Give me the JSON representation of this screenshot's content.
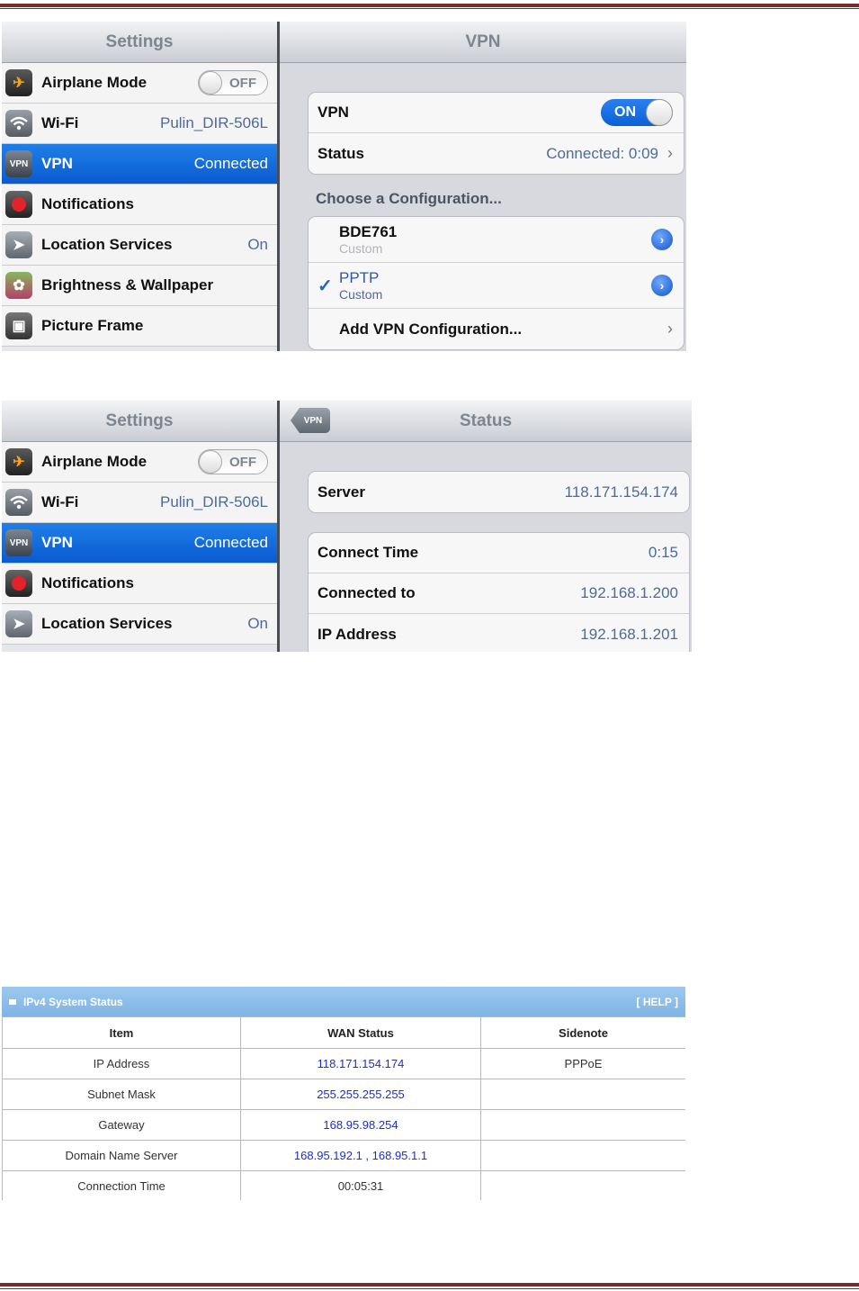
{
  "shot1": {
    "sidebar_title": "Settings",
    "detail_title": "VPN",
    "sidebar_items": [
      {
        "label": "Airplane Mode",
        "toggle": "OFF"
      },
      {
        "label": "Wi-Fi",
        "value": "Pulin_DIR-506L"
      },
      {
        "label": "VPN",
        "value": "Connected",
        "icon_text": "VPN"
      },
      {
        "label": "Notifications"
      },
      {
        "label": "Location Services",
        "value": "On"
      },
      {
        "label": "Brightness & Wallpaper"
      },
      {
        "label": "Picture Frame"
      }
    ],
    "vpn_label": "VPN",
    "vpn_toggle": "ON",
    "status_label": "Status",
    "status_value": "Connected: 0:09",
    "config_header": "Choose a Configuration...",
    "configs": [
      {
        "name": "BDE761",
        "type": "Custom",
        "checked": false
      },
      {
        "name": "PPTP",
        "type": "Custom",
        "checked": true
      }
    ],
    "checkmark": "✓",
    "add_config": "Add VPN Configuration..."
  },
  "shot2": {
    "sidebar_title": "Settings",
    "back_label": "VPN",
    "detail_title": "Status",
    "sidebar_items": [
      {
        "label": "Airplane Mode",
        "toggle": "OFF"
      },
      {
        "label": "Wi-Fi",
        "value": "Pulin_DIR-506L"
      },
      {
        "label": "VPN",
        "value": "Connected",
        "icon_text": "VPN"
      },
      {
        "label": "Notifications"
      },
      {
        "label": "Location Services",
        "value": "On"
      }
    ],
    "server": {
      "label": "Server",
      "value": "118.171.154.174"
    },
    "rows": [
      {
        "label": "Connect Time",
        "value": "0:15"
      },
      {
        "label": "Connected to",
        "value": "192.168.1.200"
      },
      {
        "label": "IP Address",
        "value": "192.168.1.201"
      }
    ]
  },
  "ipv4_table": {
    "title": "IPv4 System Status",
    "help": "[ HELP ]",
    "headers": [
      "Item",
      "WAN Status",
      "Sidenote"
    ],
    "rows": [
      [
        "IP Address",
        "118.171.154.174",
        "PPPoE"
      ],
      [
        "Subnet Mask",
        "255.255.255.255",
        ""
      ],
      [
        "Gateway",
        "168.95.98.254",
        ""
      ],
      [
        "Domain Name Server",
        "168.95.192.1 , 168.95.1.1",
        ""
      ],
      [
        "Connection Time",
        "00:05:31",
        ""
      ]
    ]
  },
  "colors": {
    "rule": "#7a2b2b",
    "ios_selected": "#0a5bd0",
    "table_header": "#8bbde9",
    "link_blue": "#1c2fcf"
  }
}
